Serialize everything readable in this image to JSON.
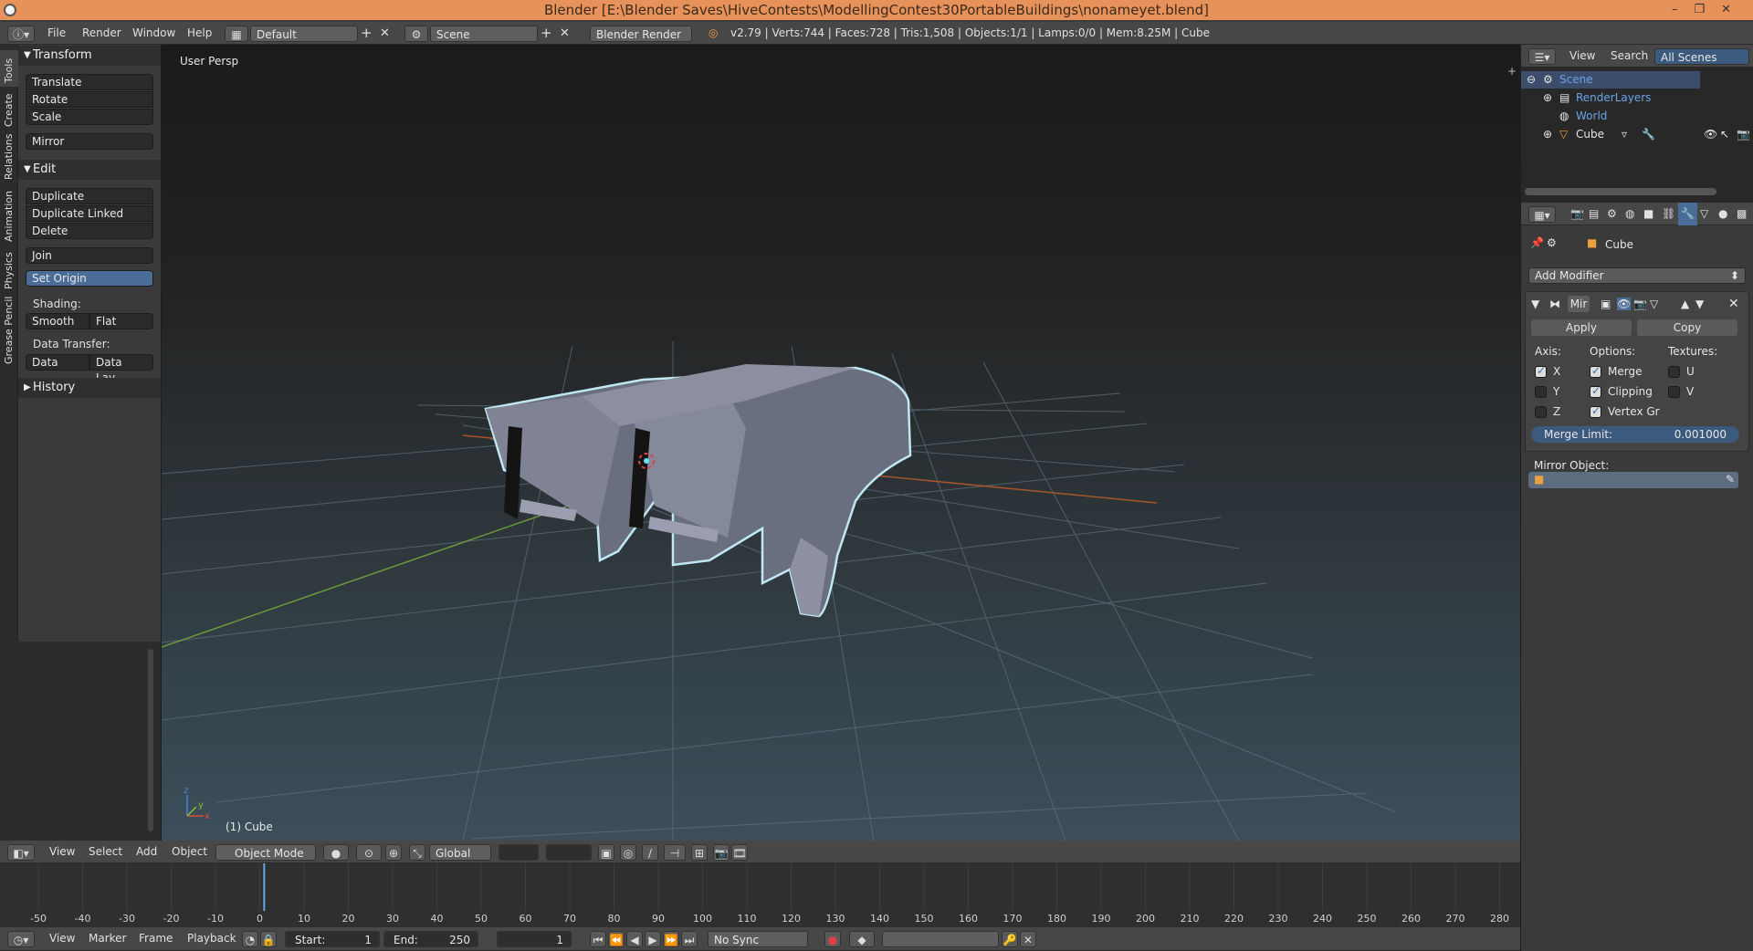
{
  "window": {
    "title": "Blender [E:\\Blender Saves\\HiveContests\\ModellingContest30PortableBuildings\\nonameyet.blend]",
    "controls": [
      "–",
      "❐",
      "✕"
    ]
  },
  "info_header": {
    "menus": [
      "File",
      "Render",
      "Window",
      "Help"
    ],
    "screen_layout": "Default",
    "scene": "Scene",
    "render_engine": "Blender Render",
    "stats": "v2.79 | Verts:744 | Faces:728 | Tris:1,508 | Objects:1/1 | Lamps:0/0 | Mem:8.25M | Cube"
  },
  "tool_tabs": [
    "Tools",
    "Create",
    "Relations",
    "Animation",
    "Physics",
    "Grease Pencil"
  ],
  "toolshelf": {
    "transform": {
      "title": "Transform",
      "buttons": [
        "Translate",
        "Rotate",
        "Scale",
        "Mirror"
      ]
    },
    "edit": {
      "title": "Edit",
      "buttons": [
        "Duplicate",
        "Duplicate Linked",
        "Delete",
        "Join",
        "Set Origin"
      ],
      "shading_label": "Shading:",
      "shading_buttons": [
        "Smooth",
        "Flat"
      ],
      "data_transfer_label": "Data Transfer:",
      "data_transfer_buttons": [
        "Data",
        "Data Lay..."
      ]
    },
    "history": {
      "title": "History"
    }
  },
  "viewport": {
    "view_label": "User Persp",
    "object_label": "(1) Cube",
    "axis_z": "z",
    "axis_y": "y",
    "axis_x": "x"
  },
  "view3d_header": {
    "menus": [
      "View",
      "Select",
      "Add",
      "Object"
    ],
    "mode": "Object Mode",
    "orientation": "Global"
  },
  "timeline": {
    "ticks": [
      "-50",
      "-40",
      "-30",
      "-20",
      "-10",
      "0",
      "10",
      "20",
      "30",
      "40",
      "50",
      "60",
      "70",
      "80",
      "90",
      "100",
      "110",
      "120",
      "130",
      "140",
      "150",
      "160",
      "170",
      "180",
      "190",
      "200",
      "210",
      "220",
      "230",
      "240",
      "250",
      "260",
      "270",
      "280"
    ],
    "current_frame_marker": 1,
    "menus": [
      "View",
      "Marker",
      "Frame",
      "Playback"
    ],
    "start_label": "Start:",
    "start_value": "1",
    "end_label": "End:",
    "end_value": "250",
    "current_frame": "1",
    "sync": "No Sync"
  },
  "outliner": {
    "header": [
      "View",
      "Search",
      "All Scenes"
    ],
    "items": [
      {
        "label": "Scene",
        "color": "#6aa3e8"
      },
      {
        "label": "RenderLayers",
        "color": "#6aa3e8"
      },
      {
        "label": "World",
        "color": "#6aa3e8"
      },
      {
        "label": "Cube",
        "color": "#e6e6e6"
      }
    ]
  },
  "properties": {
    "context_object": "Cube",
    "add_modifier": "Add Modifier",
    "modifier_name": "Mir",
    "apply": "Apply",
    "copy": "Copy",
    "axis_label": "Axis:",
    "options_label": "Options:",
    "textures_label": "Textures:",
    "axis": [
      {
        "label": "X",
        "checked": true
      },
      {
        "label": "Y",
        "checked": false
      },
      {
        "label": "Z",
        "checked": false
      }
    ],
    "options": [
      {
        "label": "Merge",
        "checked": true
      },
      {
        "label": "Clipping",
        "checked": true
      },
      {
        "label": "Vertex Gr",
        "checked": true
      }
    ],
    "textures": [
      {
        "label": "U",
        "checked": false
      },
      {
        "label": "V",
        "checked": false
      }
    ],
    "merge_limit_label": "Merge Limit:",
    "merge_limit_value": "0.001000",
    "mirror_object_label": "Mirror Object:"
  },
  "colors": {
    "title_bar": "#e8925b",
    "accent_blue": "#5680c2",
    "selection_outline": "#b9e3ef"
  }
}
